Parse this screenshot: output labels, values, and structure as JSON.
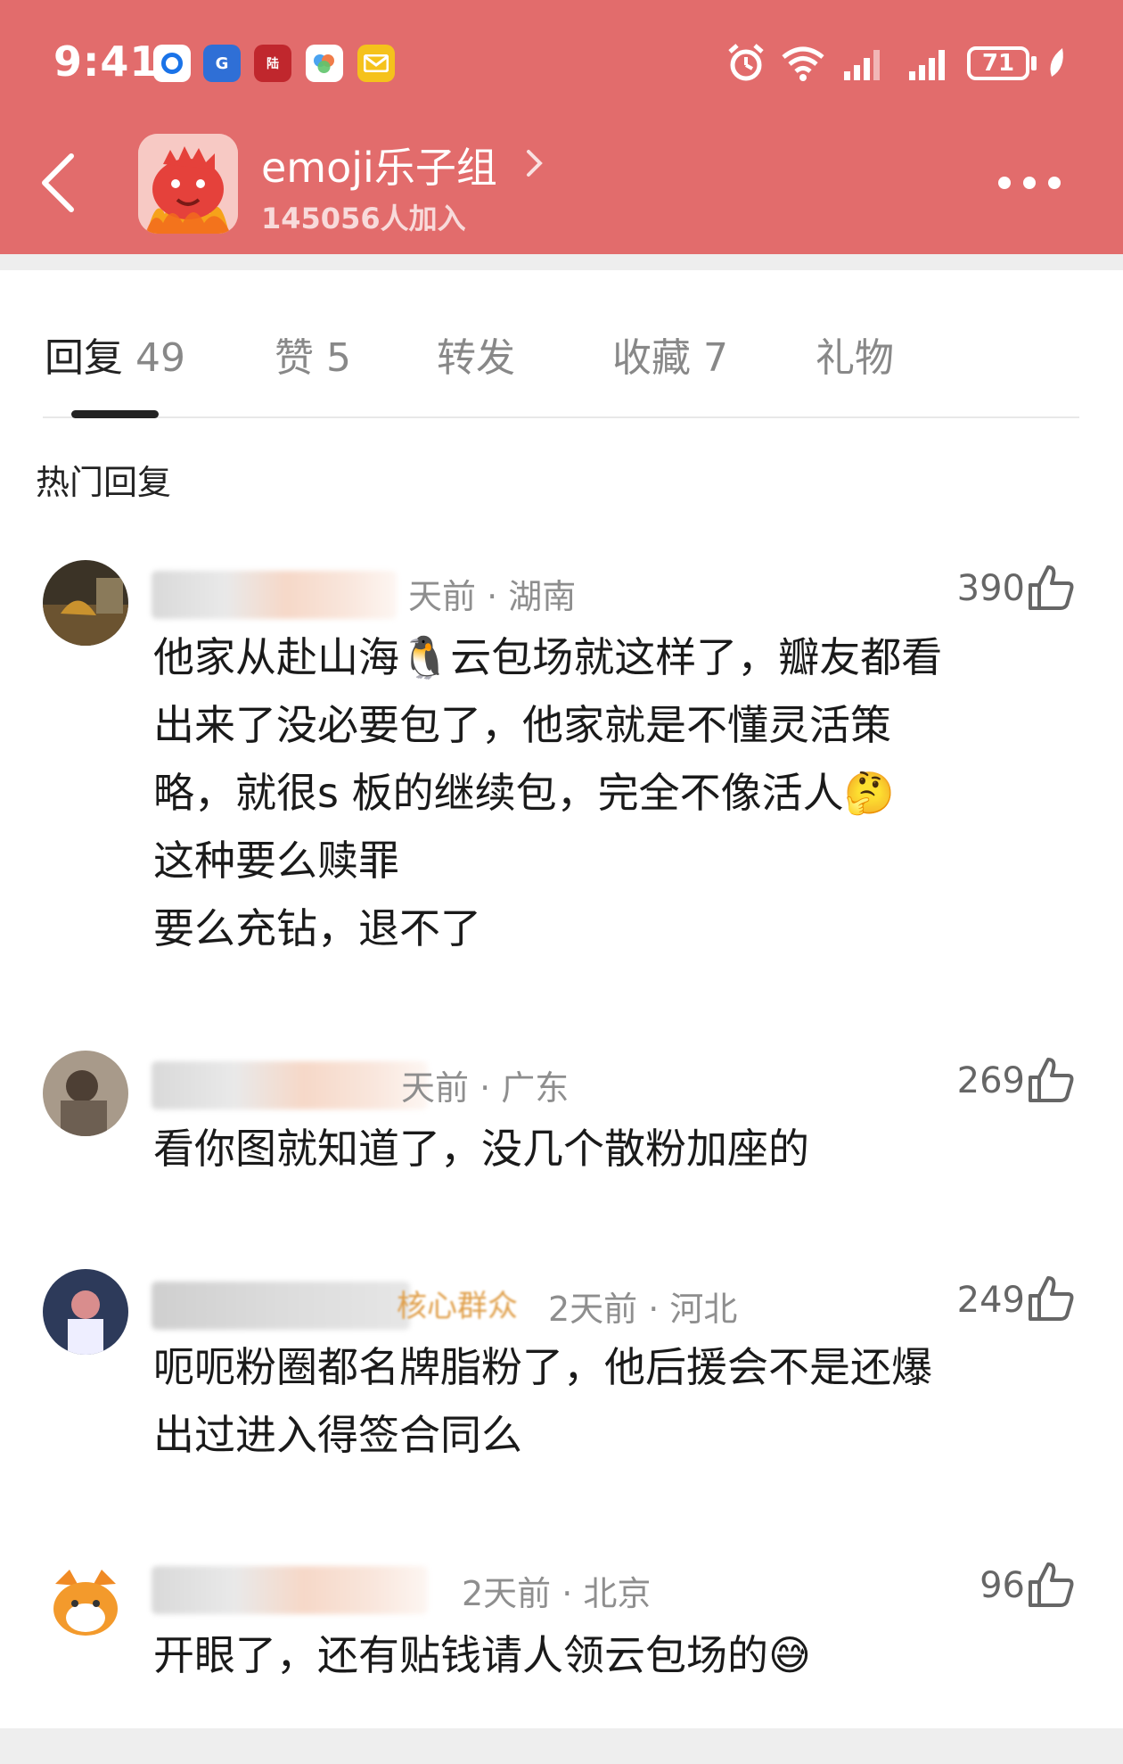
{
  "status_bar": {
    "time": "9:41",
    "battery": "71",
    "app_icons": [
      "app-circle-icon",
      "fund-app-icon",
      "luxin-fund-icon",
      "cloud-app-icon",
      "mail-icon"
    ],
    "right_icons": [
      "alarm-icon",
      "wifi-icon",
      "signal-icon",
      "signal-icon",
      "battery-icon",
      "leaf-icon"
    ]
  },
  "header": {
    "group_name": "emoji乐子组",
    "members": "145056人加入",
    "bg_color": "#e26c6c"
  },
  "tabs": [
    {
      "label": "回复",
      "count": "49"
    },
    {
      "label": "赞",
      "count": "5"
    },
    {
      "label": "转发",
      "count": ""
    },
    {
      "label": "收藏",
      "count": "7"
    },
    {
      "label": "礼物",
      "count": ""
    }
  ],
  "section_title": "热门回复",
  "comments": [
    {
      "meta": "天前 · 湖南",
      "likes": "390",
      "lines": [
        "他家从赴山海🐧云包场就这样了，瓣友都看",
        "出来了没必要包了，他家就是不懂灵活策",
        "略，就很s 板的继续包，完全不像活人🤔",
        "这种要么赎罪",
        "要么充钻，退不了"
      ]
    },
    {
      "meta": "天前 · 广东",
      "likes": "269",
      "lines": [
        "看你图就知道了，没几个散粉加座的"
      ]
    },
    {
      "badge": "核心群众",
      "meta": "2天前 · 河北",
      "likes": "249",
      "lines": [
        "呃呃粉圈都名牌脂粉了，他后援会不是还爆",
        "出过进入得签合同么"
      ]
    },
    {
      "meta": "2天前 · 北京",
      "likes": "96",
      "lines": [
        "开眼了，还有贴钱请人领云包场的😅"
      ]
    }
  ]
}
